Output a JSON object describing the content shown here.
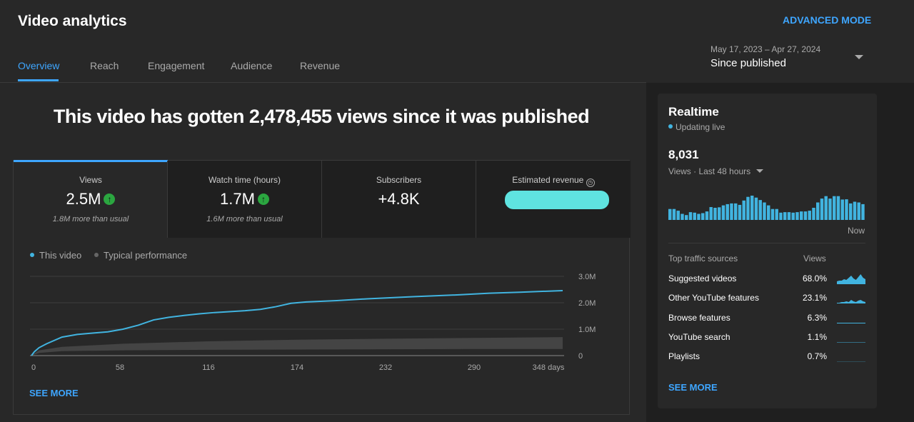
{
  "header": {
    "title": "Video analytics",
    "advanced_mode": "ADVANCED MODE",
    "tabs": [
      "Overview",
      "Reach",
      "Engagement",
      "Audience",
      "Revenue"
    ],
    "date_range": "May 17, 2023 – Apr 27, 2024",
    "period": "Since published"
  },
  "headline": "This video has gotten 2,478,455 views since it was published",
  "metrics": [
    {
      "label": "Views",
      "value": "2.5M",
      "trend": "up",
      "sub": "1.8M more than usual"
    },
    {
      "label": "Watch time (hours)",
      "value": "1.7M",
      "trend": "up",
      "sub": "1.6M more than usual"
    },
    {
      "label": "Subscribers",
      "value": "+4.8K"
    },
    {
      "label": "Estimated revenue",
      "value_redacted": true
    }
  ],
  "legend": {
    "this_video": "This video",
    "typical": "Typical performance"
  },
  "see_more": "SEE MORE",
  "colors": {
    "accent": "#3ea6ff",
    "line": "#41b4e0",
    "typical": "#444444",
    "up": "#2ba640"
  },
  "chart_data": {
    "type": "line",
    "xlabel": "",
    "ylabel": "",
    "x_ticks": [
      "0",
      "58",
      "116",
      "174",
      "232",
      "290",
      "348 days"
    ],
    "y_ticks": [
      "0",
      "1.0M",
      "2.0M",
      "3.0M"
    ],
    "xlim": [
      0,
      348
    ],
    "ylim": [
      0,
      3000000
    ],
    "series": [
      {
        "name": "This video",
        "x": [
          0,
          2,
          5,
          10,
          20,
          30,
          40,
          50,
          60,
          70,
          80,
          90,
          100,
          110,
          120,
          140,
          150,
          160,
          170,
          180,
          200,
          220,
          250,
          280,
          300,
          320,
          348
        ],
        "y": [
          0,
          150000,
          300000,
          450000,
          700000,
          800000,
          850000,
          900000,
          1000000,
          1150000,
          1350000,
          1450000,
          1520000,
          1580000,
          1630000,
          1700000,
          1750000,
          1850000,
          1980000,
          2030000,
          2080000,
          2150000,
          2230000,
          2300000,
          2360000,
          2400000,
          2460000
        ]
      },
      {
        "name": "Typical performance",
        "x": [
          0,
          5,
          20,
          60,
          116,
          174,
          232,
          290,
          348
        ],
        "lower": [
          0,
          100000,
          170000,
          200000,
          220000,
          230000,
          240000,
          250000,
          250000
        ],
        "upper": [
          0,
          200000,
          330000,
          450000,
          540000,
          600000,
          640000,
          670000,
          700000
        ]
      }
    ]
  },
  "realtime": {
    "title": "Realtime",
    "status": "Updating live",
    "count": "8,031",
    "period": "Views · Last 48 hours",
    "now": "Now",
    "bars": [
      45,
      45,
      38,
      25,
      20,
      32,
      30,
      25,
      28,
      35,
      53,
      50,
      52,
      60,
      65,
      68,
      68,
      62,
      80,
      95,
      100,
      92,
      82,
      72,
      60,
      45,
      45,
      30,
      32,
      32,
      30,
      32,
      35,
      35,
      38,
      50,
      72,
      88,
      98,
      88,
      98,
      98,
      84,
      85,
      68,
      75,
      72,
      65
    ],
    "traffic_header": "Top traffic sources",
    "views_header": "Views",
    "sources": [
      {
        "name": "Suggested videos",
        "pct": "68.0%",
        "spark": [
          4,
          5,
          5,
          7,
          6,
          9,
          12,
          8,
          6,
          10,
          14,
          9,
          7
        ]
      },
      {
        "name": "Other YouTube features",
        "pct": "23.1%",
        "spark": [
          1,
          1,
          2,
          2,
          3,
          2,
          5,
          3,
          2,
          4,
          5,
          3,
          2
        ]
      },
      {
        "name": "Browse features",
        "pct": "6.3%",
        "spark": [
          1,
          1,
          1,
          1,
          1,
          1,
          1,
          1,
          1,
          1,
          1,
          1,
          1
        ]
      },
      {
        "name": "YouTube search",
        "pct": "1.1%",
        "spark": [
          0.5,
          0.5,
          0.5,
          0.5,
          0.5,
          0.5,
          0.5,
          0.5,
          0.5,
          0.5,
          0.5,
          0.5,
          0.5
        ]
      },
      {
        "name": "Playlists",
        "pct": "0.7%",
        "spark": [
          0.3,
          0.3,
          0.3,
          0.3,
          0.3,
          0.3,
          0.3,
          0.3,
          0.3,
          0.3,
          0.3,
          0.3,
          0.3
        ]
      }
    ],
    "see_more": "SEE MORE"
  }
}
